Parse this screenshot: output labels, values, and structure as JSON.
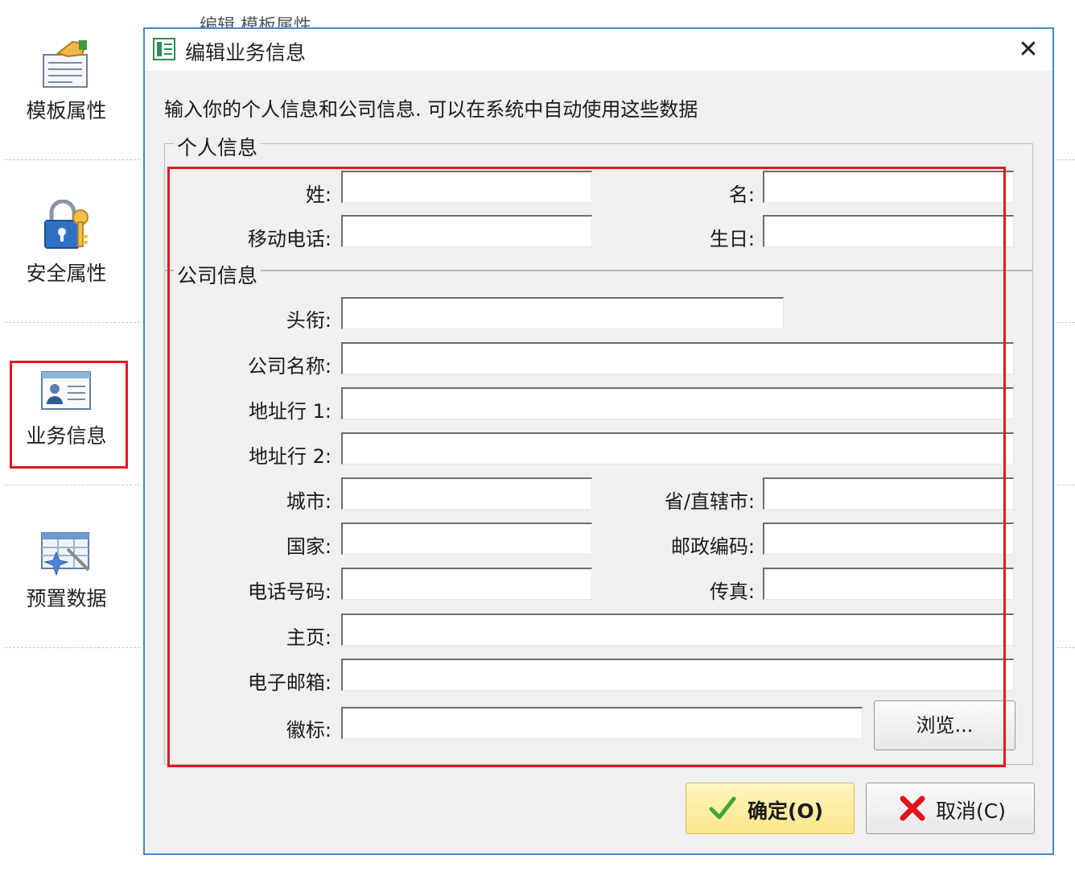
{
  "background_tabs": "编辑   模板属性",
  "sidebar": {
    "items": [
      {
        "label": "模板属性",
        "icon": "template-properties-icon"
      },
      {
        "label": "安全属性",
        "icon": "security-lock-key-icon"
      },
      {
        "label": "业务信息",
        "icon": "business-card-icon",
        "selected": true
      },
      {
        "label": "预置数据",
        "icon": "preset-data-icon"
      }
    ]
  },
  "dialog": {
    "title": "编辑业务信息",
    "close_glyph": "✕",
    "instruction": "输入你的个人信息和公司信息. 可以在系统中自动使用这些数据",
    "personal": {
      "title": "个人信息",
      "last_name_label": "姓:",
      "first_name_label": "名:",
      "mobile_label": "移动电话:",
      "birthday_label": "生日:"
    },
    "company": {
      "title": "公司信息",
      "job_title_label": "头衔:",
      "company_name_label": "公司名称:",
      "address1_label": "地址行 1:",
      "address2_label": "地址行 2:",
      "city_label": "城市:",
      "province_label": "省/直辖市:",
      "country_label": "国家:",
      "postal_label": "邮政编码:",
      "phone_label": "电话号码:",
      "fax_label": "传真:",
      "homepage_label": "主页:",
      "email_label": "电子邮箱:",
      "logo_label": "徽标:",
      "browse_label": "浏览..."
    },
    "ok_label": "确定(O)",
    "cancel_label": "取消(C)"
  },
  "colors": {
    "highlight": "#e3161f",
    "dialog_border": "#4a86c8",
    "ok_button": "#fbe58a"
  }
}
